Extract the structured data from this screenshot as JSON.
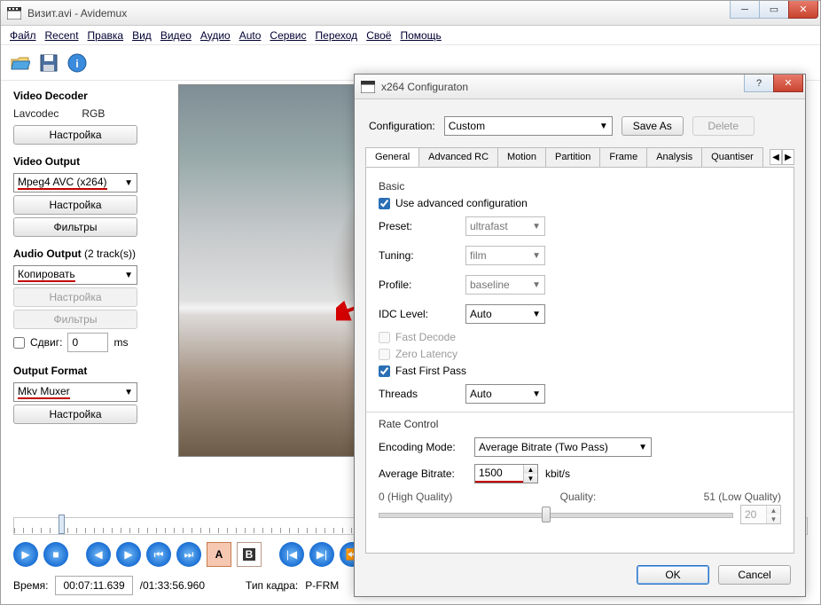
{
  "window": {
    "title": "Визит.avi - Avidemux"
  },
  "menu": [
    "Файл",
    "Recent",
    "Правка",
    "Вид",
    "Видео",
    "Аудио",
    "Auto",
    "Сервис",
    "Переход",
    "Своё",
    "Помощь"
  ],
  "left": {
    "video_decoder_title": "Video Decoder",
    "decoder_name": "Lavcodec",
    "decoder_cs": "RGB",
    "configure": "Настройка",
    "video_output_title": "Video Output",
    "video_codec": "Mpeg4 AVC (x264)",
    "filters": "Фильтры",
    "audio_output_title": "Audio Output",
    "audio_tracks": "(2 track(s))",
    "audio_mode": "Копировать",
    "shift_label": "Сдвиг:",
    "shift_value": "0",
    "shift_unit": "ms",
    "output_format_title": "Output Format",
    "muxer": "Mkv Muxer"
  },
  "status": {
    "time_label": "Время:",
    "time_value": "00:07:11.639",
    "total": "/01:33:56.960",
    "frame_label": "Тип кадра:",
    "frame_value": "P-FRM"
  },
  "dialog": {
    "title": "x264 Configuraton",
    "config_label": "Configuration:",
    "config_value": "Custom",
    "save_as": "Save As",
    "delete": "Delete",
    "tabs": [
      "General",
      "Advanced RC",
      "Motion",
      "Partition",
      "Frame",
      "Analysis",
      "Quantiser"
    ],
    "basic": "Basic",
    "use_adv": "Use advanced configuration",
    "preset_l": "Preset:",
    "preset_v": "ultrafast",
    "tuning_l": "Tuning:",
    "tuning_v": "film",
    "profile_l": "Profile:",
    "profile_v": "baseline",
    "idc_l": "IDC Level:",
    "idc_v": "Auto",
    "fast_decode": "Fast Decode",
    "zero_latency": "Zero Latency",
    "fast_first_pass": "Fast First Pass",
    "threads_l": "Threads",
    "threads_v": "Auto",
    "ratectl": "Rate Control",
    "enc_mode_l": "Encoding Mode:",
    "enc_mode_v": "Average Bitrate (Two Pass)",
    "avg_br_l": "Average Bitrate:",
    "avg_br_v": "1500",
    "avg_br_u": "kbit/s",
    "hq": "0 (High Quality)",
    "q": "Quality:",
    "lq": "51 (Low Quality)",
    "qv": "20",
    "ok": "OK",
    "cancel": "Cancel"
  }
}
